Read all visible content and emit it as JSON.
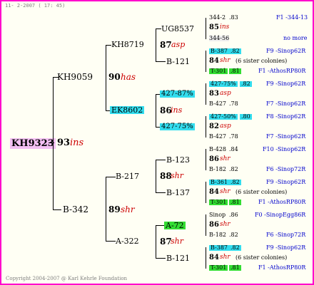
{
  "header": "11- 2-2007 ( 17: 45)",
  "footer": "Copyright 2004-2007 @ Karl Kehrle Foundation",
  "colors": {
    "border": "#ff00cc",
    "cyan": "#33ddee",
    "green": "#33dd33",
    "pink": "#f4c0f4",
    "accent_red": "#cc0000",
    "blue_text": "#0000cc"
  },
  "root": {
    "name": "KH9323",
    "year": "93",
    "breed": "ins"
  },
  "gen1": [
    {
      "name": "KH9059",
      "year": "90",
      "breed": "has"
    },
    {
      "name": "B-342",
      "year": "89",
      "breed": "shr"
    }
  ],
  "gen2": [
    {
      "name": "KH8719",
      "year": "87",
      "breed": "asp"
    },
    {
      "name": "EK8602",
      "year": "86",
      "breed": "ins"
    },
    {
      "name": "B-217",
      "year": "88",
      "breed": "shr"
    },
    {
      "name": "A-322",
      "year": "87",
      "breed": "shr"
    }
  ],
  "gen3": [
    "UG8537",
    "B-121",
    "427-87%",
    "427-75%",
    "B-123",
    "B-137",
    "A-72",
    "B-121"
  ],
  "gen4": [
    {
      "lines": [
        {
          "name": "344-2",
          "val": ".83",
          "ref": "F1 -344-13"
        },
        {
          "year": "85",
          "breed": "ins"
        },
        {
          "name": "344-56",
          "val": "",
          "ref": "no more"
        }
      ]
    },
    {
      "lines": [
        {
          "name": "B-387",
          "val": ".82",
          "ref": "F9 -Sinop62R"
        },
        {
          "year": "84",
          "breed": "shr",
          "note": "(6 sister colonies)"
        },
        {
          "name": "T-301",
          "val": ".81",
          "ref": "F1 -AthosRP80R"
        }
      ]
    },
    {
      "lines": [
        {
          "name": "427-75%",
          "val": ".82",
          "ref": "F9 -Sinop62R"
        },
        {
          "year": "83",
          "breed": "asp"
        },
        {
          "name": "B-427",
          "val": ".78",
          "ref": "F7 -Sinop62R"
        }
      ]
    },
    {
      "lines": [
        {
          "name": "427-50%",
          "val": ".80",
          "ref": "F8 -Sinop62R"
        },
        {
          "year": "82",
          "breed": "asp"
        },
        {
          "name": "B-427",
          "val": ".78",
          "ref": "F7 -Sinop62R"
        }
      ]
    },
    {
      "lines": [
        {
          "name": "B-428",
          "val": ".84",
          "ref": "F10 -Sinop62R"
        },
        {
          "year": "86",
          "breed": "shr"
        },
        {
          "name": "B-182",
          "val": ".82",
          "ref": "F6 -Sinop72R"
        }
      ]
    },
    {
      "lines": [
        {
          "name": "B-361",
          "val": ".82",
          "ref": "F9 -Sinop62R"
        },
        {
          "year": "84",
          "breed": "shr",
          "note": "(6 sister colonies)"
        },
        {
          "name": "T-301",
          "val": ".81",
          "ref": "F1 -AthosRP80R"
        }
      ]
    },
    {
      "lines": [
        {
          "name": "Sinop",
          "val": ".86",
          "ref": "F0 -SinopEgg86R"
        },
        {
          "year": "86",
          "breed": "shr"
        },
        {
          "name": "B-182",
          "val": ".82",
          "ref": "F6 -Sinop72R"
        }
      ]
    },
    {
      "lines": [
        {
          "name": "B-387",
          "val": ".82",
          "ref": "F9 -Sinop62R"
        },
        {
          "year": "84",
          "breed": "shr",
          "note": "(6 sister colonies)"
        },
        {
          "name": "T-301",
          "val": ".81",
          "ref": "F1 -AthosRP80R"
        }
      ]
    }
  ]
}
